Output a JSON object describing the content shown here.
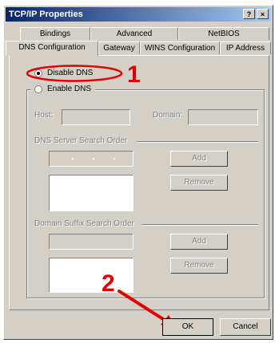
{
  "window": {
    "title": "TCP/IP Properties",
    "help_label": "?",
    "close_label": "×"
  },
  "tabs": {
    "row_back": [
      "Bindings",
      "Advanced",
      "NetBIOS"
    ],
    "row_front": [
      "DNS Configuration",
      "Gateway",
      "WINS Configuration",
      "IP Address"
    ]
  },
  "dns": {
    "disable_label": "Disable DNS",
    "enable_label": "Enable DNS",
    "host_label": "Host:",
    "domain_label": "Domain:",
    "server_order_label": "DNS Server Search Order",
    "add_label": "Add",
    "remove_label": "Remove",
    "suffix_order_label": "Domain Suffix Search Order",
    "add2_label": "Add",
    "remove2_label": "Remove"
  },
  "footer": {
    "ok_label": "OK",
    "cancel_label": "Cancel"
  },
  "annotations": {
    "step1": "1",
    "step2": "2",
    "color": "#e00000"
  }
}
